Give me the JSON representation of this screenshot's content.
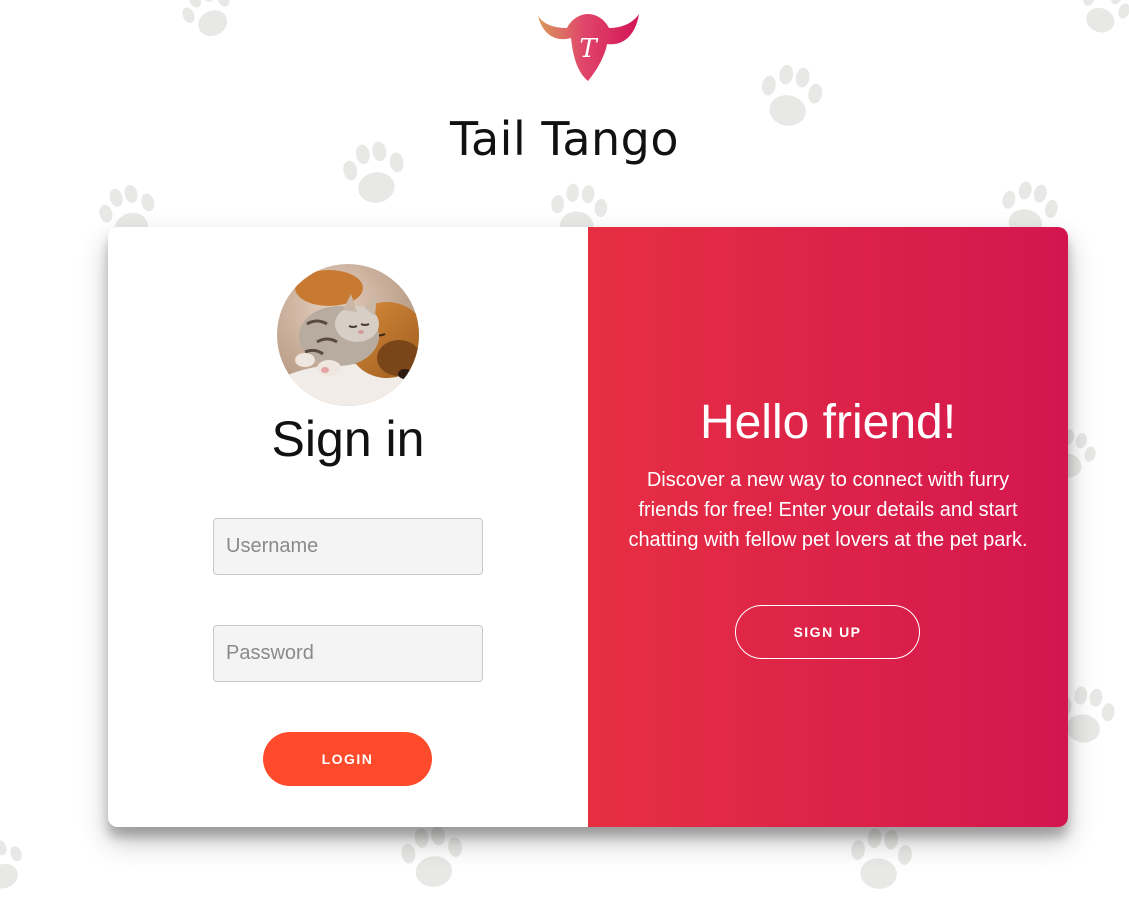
{
  "app": {
    "title": "Tail Tango",
    "logo_icon": "tail-tango-logo-icon",
    "logo_letter": "T"
  },
  "signin": {
    "avatar_icon": "sleeping-kitten-and-puppy-photo",
    "title": "Sign in",
    "username_placeholder": "Username",
    "username_value": "",
    "password_placeholder": "Password",
    "password_value": "",
    "login_label": "LOGIN"
  },
  "overlay": {
    "title": "Hello friend!",
    "text": "Discover a new way to connect with furry friends for free! Enter your details and start chatting with fellow pet lovers at the pet park.",
    "signup_label": "SIGN UP"
  },
  "background": {
    "pattern_icon": "paw-print-icon"
  },
  "colors": {
    "login_button": "#ff4b2b",
    "overlay_gradient_start": "#e72f42",
    "overlay_gradient_end": "#d3164f",
    "paw_pattern": "#e6e6e6"
  }
}
